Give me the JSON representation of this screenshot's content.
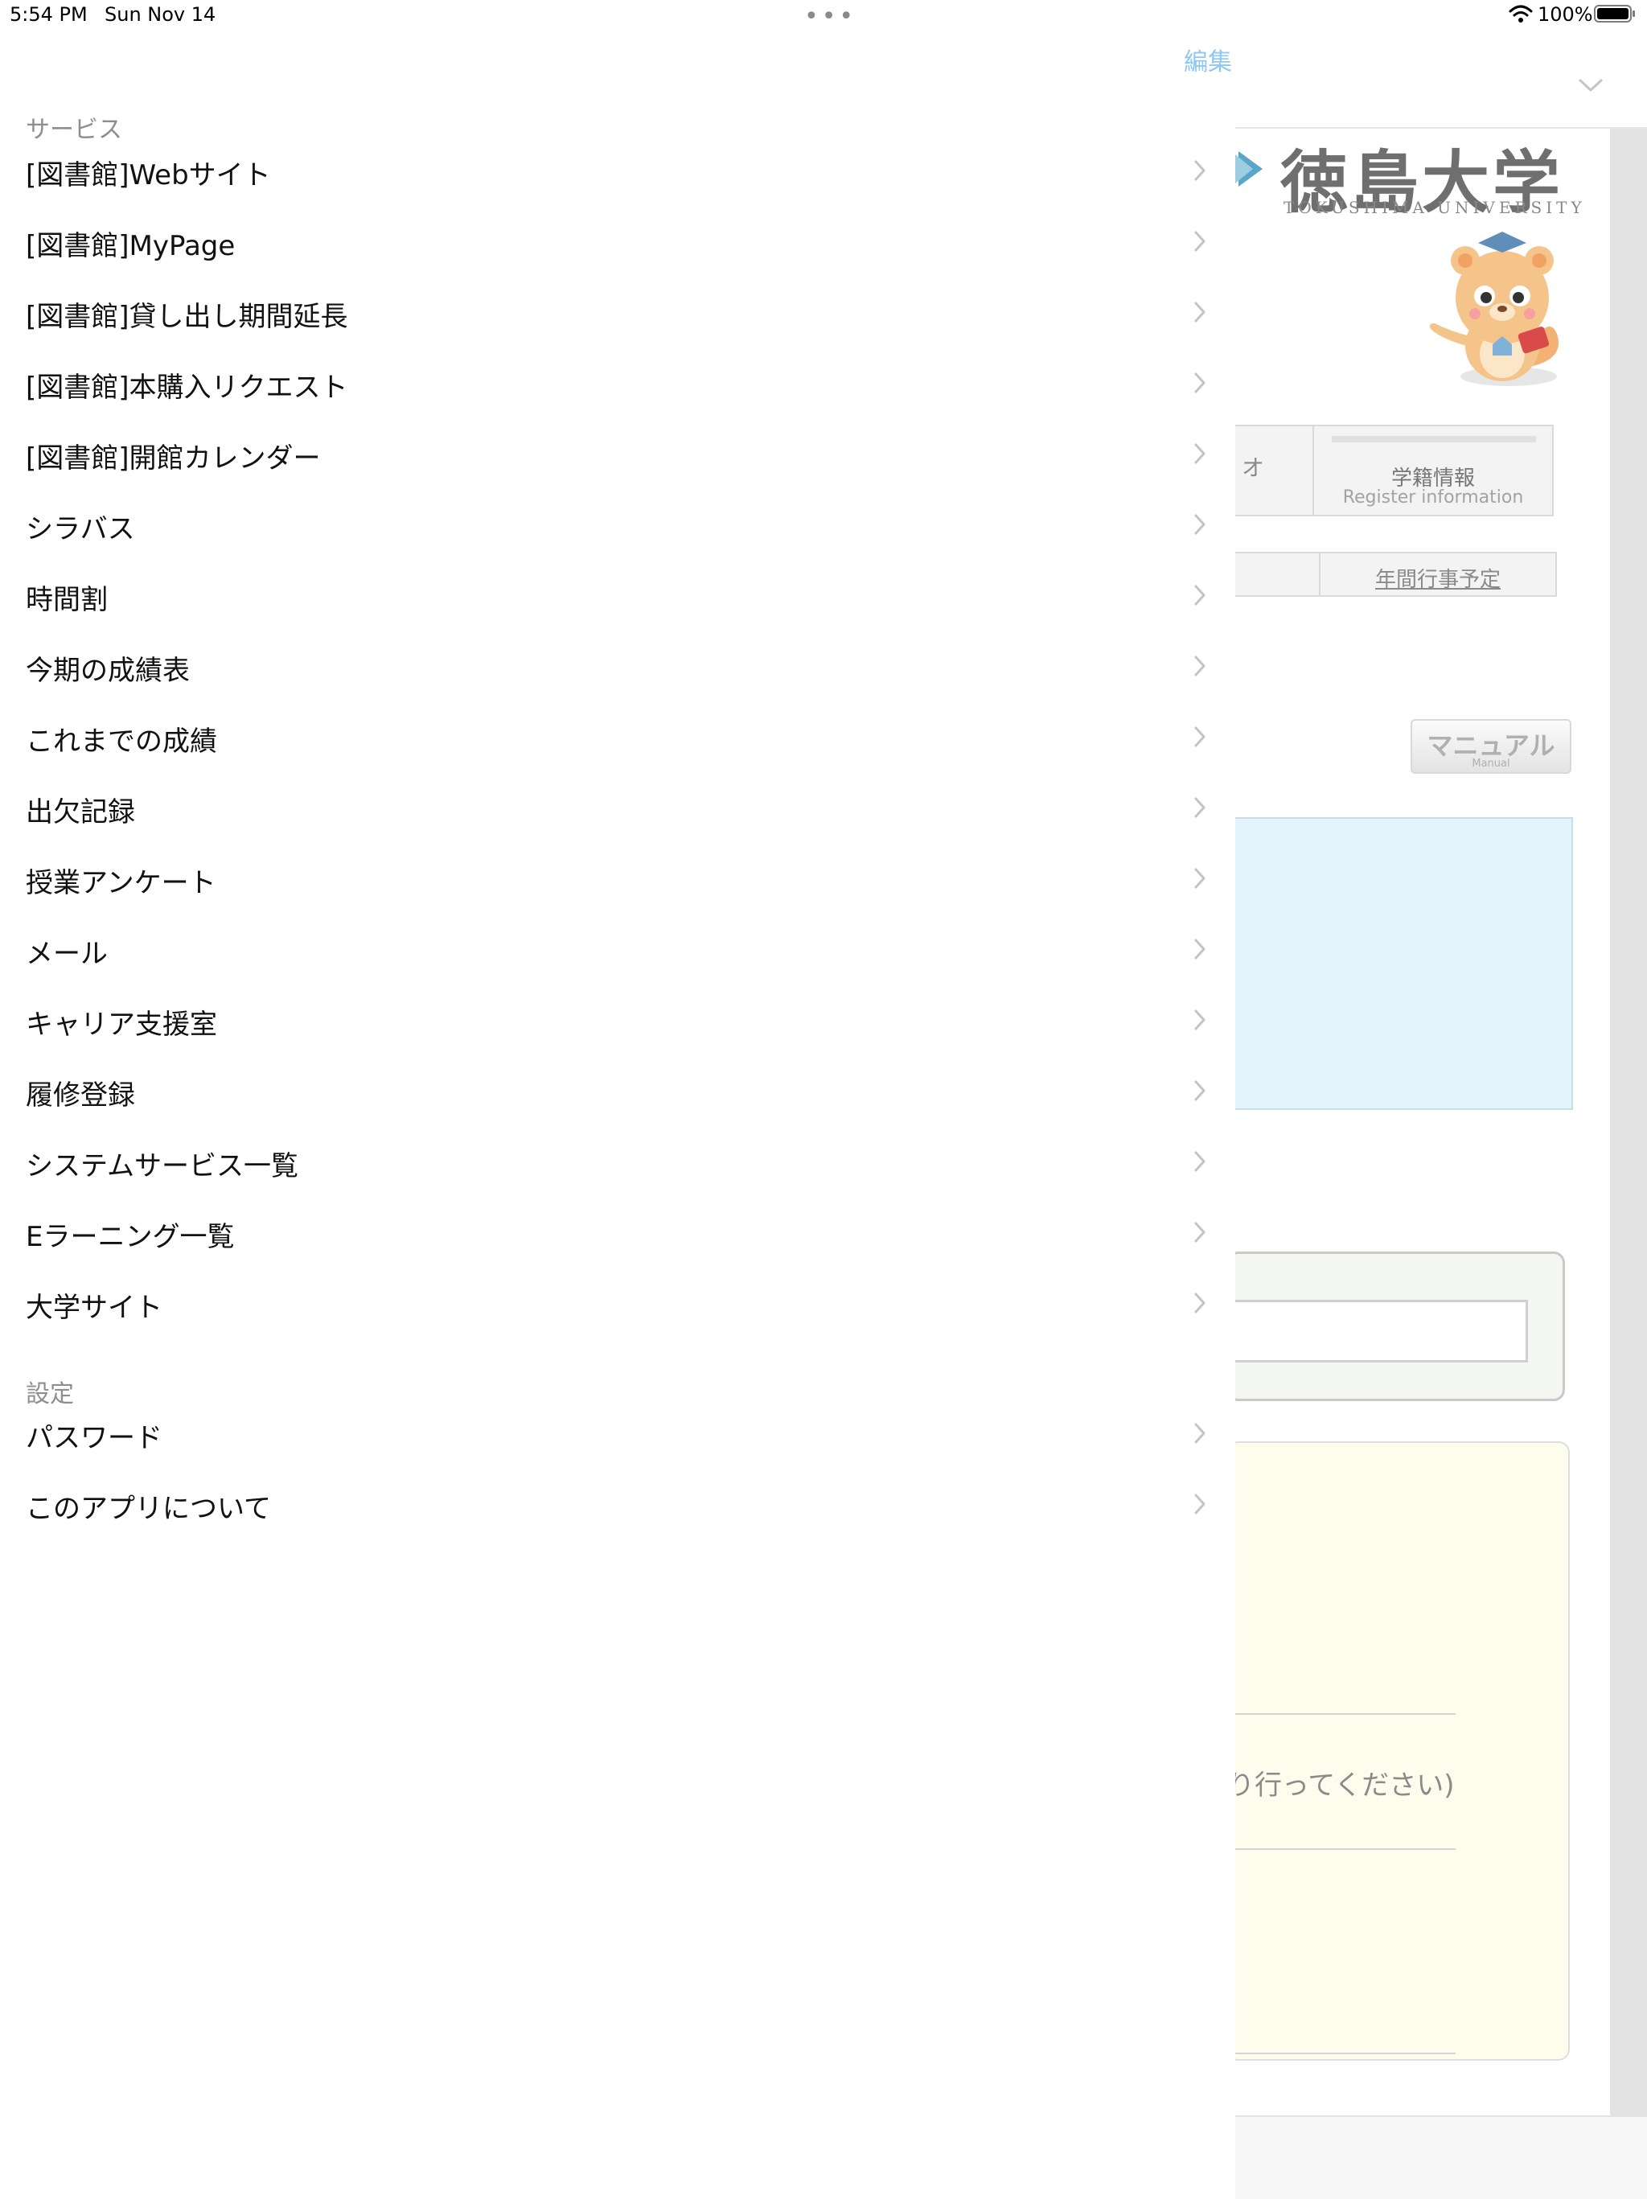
{
  "status_bar": {
    "time": "5:54 PM",
    "date": "Sun Nov 14",
    "dots": "•••",
    "battery_percent": "100%"
  },
  "toolbar": {
    "edit_label": "編集"
  },
  "menu": {
    "sections": [
      {
        "header": "サービス",
        "items": [
          {
            "label": "[図書館]Webサイト"
          },
          {
            "label": "[図書館]MyPage"
          },
          {
            "label": "[図書館]貸し出し期間延長"
          },
          {
            "label": "[図書館]本購入リクエスト"
          },
          {
            "label": "[図書館]開館カレンダー"
          },
          {
            "label": "シラバス"
          },
          {
            "label": "時間割"
          },
          {
            "label": "今期の成績表"
          },
          {
            "label": "これまでの成績"
          },
          {
            "label": "出欠記録"
          },
          {
            "label": "授業アンケート"
          },
          {
            "label": "メール"
          },
          {
            "label": "キャリア支援室"
          },
          {
            "label": "履修登録"
          },
          {
            "label": "システムサービス一覧"
          },
          {
            "label": "Eラーニング一覧"
          },
          {
            "label": "大学サイト"
          }
        ]
      },
      {
        "header": "設定",
        "items": [
          {
            "label": "パスワード"
          },
          {
            "label": "このアプリについて"
          }
        ]
      }
    ]
  },
  "web": {
    "university_name": "徳島大学",
    "university_name_en": "TOKUSHIMA UNIVERSITY",
    "partial_button_label": "オ",
    "register_button_ja": "学籍情報",
    "register_button_en": "Register information",
    "calendar_link": "年間行事予定",
    "manual_button_ja": "マニュアル",
    "manual_button_en": "Manual",
    "notice_text": "り行ってください)"
  },
  "colors": {
    "accent": "#8ec8ee",
    "chevron": "#c4c4c8",
    "section_header": "#8e8e8e",
    "info_box": "#e4f4fd",
    "notice_box": "#fdfded"
  }
}
